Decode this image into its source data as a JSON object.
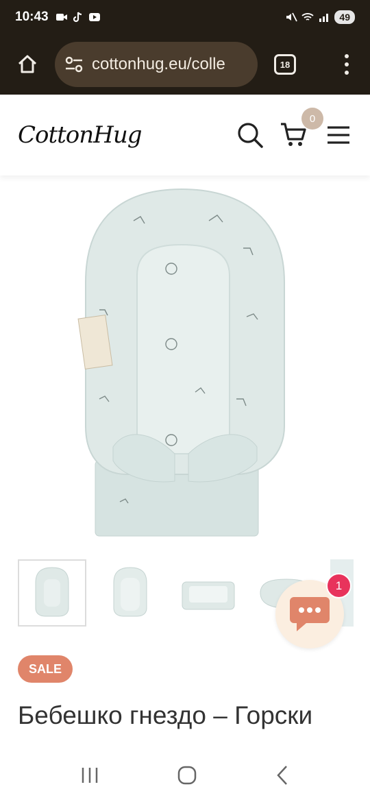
{
  "status_bar": {
    "time": "10:43",
    "battery": "49"
  },
  "browser": {
    "url": "cottonhug.eu/colle",
    "tab_count": "18"
  },
  "site": {
    "logo": "CottonHug",
    "cart_count": "0"
  },
  "product": {
    "sale_label": "SALE",
    "title": "Бебешко гнездо – Горски животни"
  },
  "chat": {
    "badge_count": "1"
  },
  "colors": {
    "sale": "#e0856a",
    "badge": "#e8335c",
    "chat_bg": "#fbeee0",
    "product_fill": "#dfe9e7"
  }
}
